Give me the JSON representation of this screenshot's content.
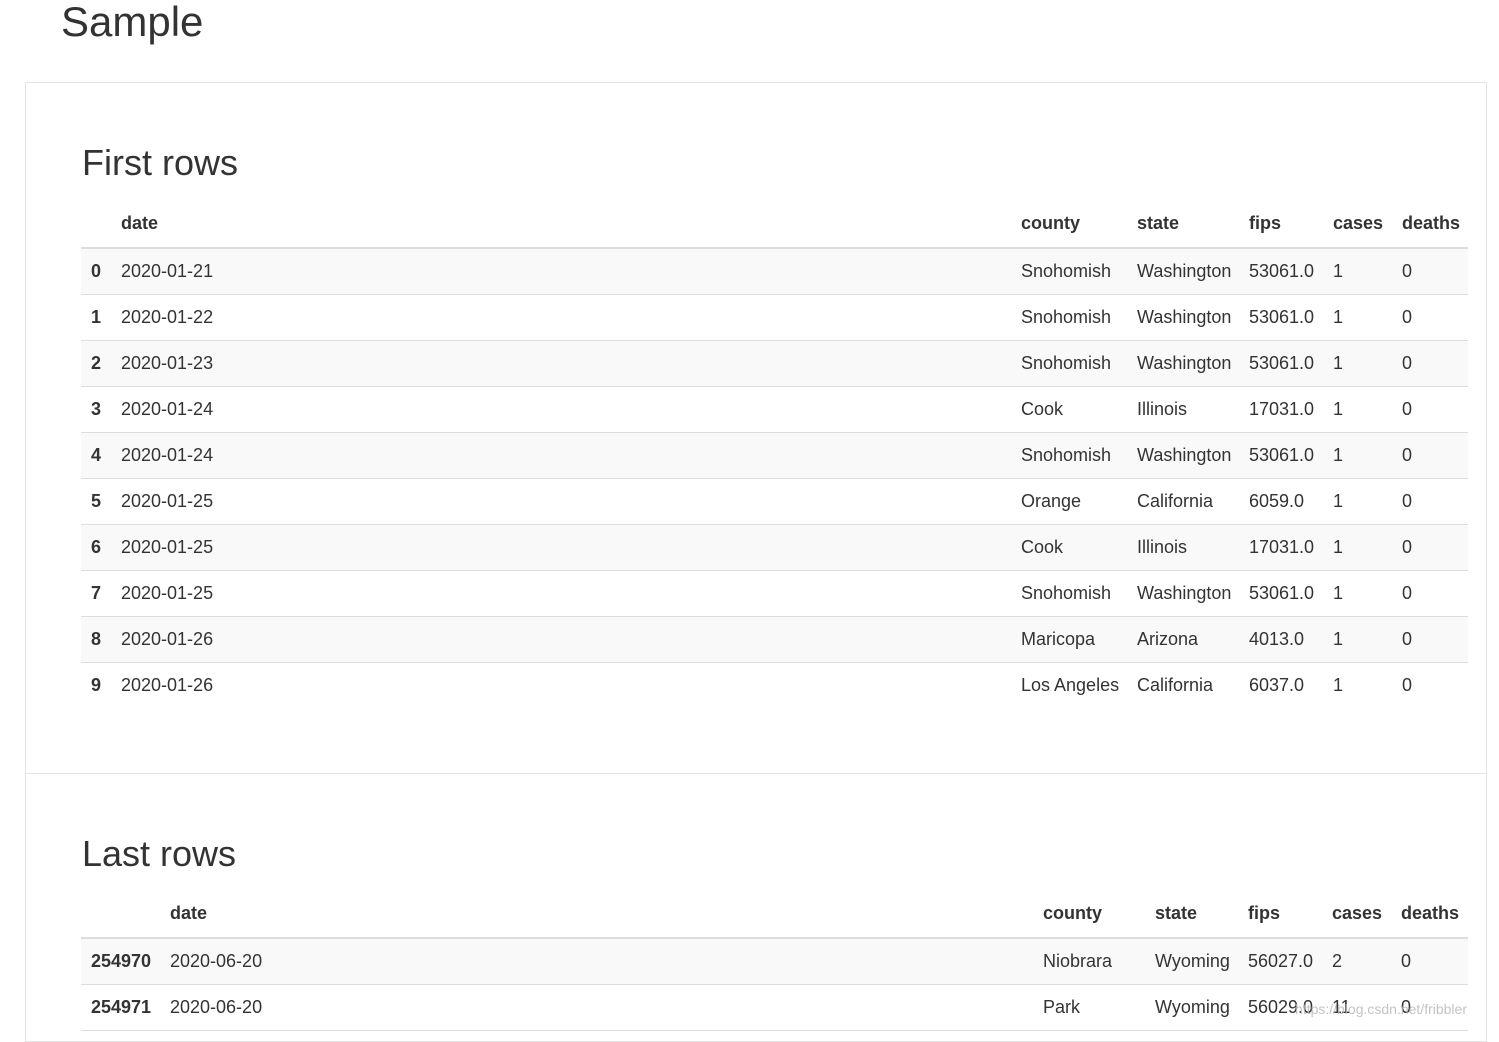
{
  "page": {
    "title": "Sample"
  },
  "first_rows": {
    "heading": "First rows",
    "columns": [
      "",
      "date",
      "county",
      "state",
      "fips",
      "cases",
      "deaths"
    ],
    "rows": [
      [
        "0",
        "2020-01-21",
        "Snohomish",
        "Washington",
        "53061.0",
        "1",
        "0"
      ],
      [
        "1",
        "2020-01-22",
        "Snohomish",
        "Washington",
        "53061.0",
        "1",
        "0"
      ],
      [
        "2",
        "2020-01-23",
        "Snohomish",
        "Washington",
        "53061.0",
        "1",
        "0"
      ],
      [
        "3",
        "2020-01-24",
        "Cook",
        "Illinois",
        "17031.0",
        "1",
        "0"
      ],
      [
        "4",
        "2020-01-24",
        "Snohomish",
        "Washington",
        "53061.0",
        "1",
        "0"
      ],
      [
        "5",
        "2020-01-25",
        "Orange",
        "California",
        "6059.0",
        "1",
        "0"
      ],
      [
        "6",
        "2020-01-25",
        "Cook",
        "Illinois",
        "17031.0",
        "1",
        "0"
      ],
      [
        "7",
        "2020-01-25",
        "Snohomish",
        "Washington",
        "53061.0",
        "1",
        "0"
      ],
      [
        "8",
        "2020-01-26",
        "Maricopa",
        "Arizona",
        "4013.0",
        "1",
        "0"
      ],
      [
        "9",
        "2020-01-26",
        "Los Angeles",
        "California",
        "6037.0",
        "1",
        "0"
      ]
    ]
  },
  "last_rows": {
    "heading": "Last rows",
    "columns": [
      "",
      "date",
      "county",
      "state",
      "fips",
      "cases",
      "deaths"
    ],
    "rows": [
      [
        "254970",
        "2020-06-20",
        "Niobrara",
        "Wyoming",
        "56027.0",
        "2",
        "0"
      ],
      [
        "254971",
        "2020-06-20",
        "Park",
        "Wyoming",
        "56029.0",
        "11",
        "0"
      ]
    ]
  },
  "watermark": "https://blog.csdn.net/fribbler",
  "colors": {
    "text": "#333333",
    "stripe": "#f9f9f9",
    "border": "#dddddd",
    "panel_border": "#e5e5e5"
  }
}
